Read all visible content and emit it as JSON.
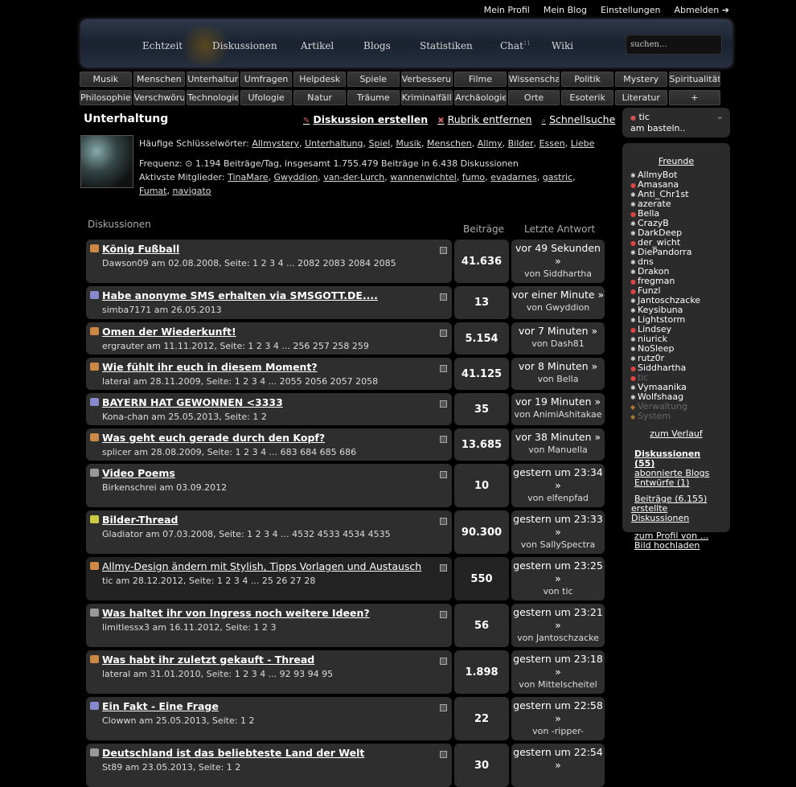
{
  "topnav": [
    "Mein Profil",
    "Mein Blog",
    "Einstellungen",
    "Abmelden ➔"
  ],
  "mainnav": {
    "items": [
      "Echtzeit",
      "Diskussionen",
      "Artikel",
      "Blogs",
      "Statistiken",
      "Chat",
      "Wiki"
    ],
    "chat_badge": "11"
  },
  "search": {
    "placeholder": "suchen..."
  },
  "categories_row1": [
    "Musik",
    "Menschen",
    "Unterhaltung",
    "Umfragen",
    "Helpdesk",
    "Spiele",
    "Verbesserungen",
    "Filme",
    "Wissenschaft",
    "Politik",
    "Mystery",
    "Spiritualität"
  ],
  "categories_row2": [
    "Philosophie",
    "Verschwörungen",
    "Technologie",
    "Ufologie",
    "Natur",
    "Träume",
    "Kriminalfälle",
    "Archäologie",
    "Orte",
    "Esoterik",
    "Literatur",
    "+"
  ],
  "page": {
    "title": "Unterhaltung",
    "create": "Diskussion erstellen",
    "remove": "Rubrik entfernen",
    "quick": "Schnellsuche"
  },
  "info": {
    "keywords_label": "Häufige Schlüsselwörter:",
    "keywords": [
      "Allmystery",
      "Unterhaltung",
      "Spiel",
      "Musik",
      "Menschen",
      "Allmy",
      "Bilder",
      "Essen",
      "Liebe"
    ],
    "freq": "Frequenz: ⊙ 1.194 Beiträge/Tag, insgesamt 1.755.479 Beiträge in 6.438 Diskussionen",
    "active_label": "Aktivste Mitglieder:",
    "active": [
      "TinaMare",
      "Gwyddion",
      "van-der-Lurch",
      "wannenwichtel",
      "fumo",
      "evadarnes",
      "gastric",
      "Fumat",
      "navigato"
    ]
  },
  "table": {
    "heading": "Diskussionen",
    "col_posts": "Beiträge",
    "col_last": "Letzte Antwort"
  },
  "threads": [
    {
      "title": "König Fußball",
      "meta": "Dawson09 am 02.08.2008, Seite: 1 2 3 4 ... 2082 2083 2084 2085",
      "posts": "41.636",
      "last": "vor 49 Sekunden »",
      "by": "von Siddhartha",
      "icon": "#c84",
      "bold": true
    },
    {
      "title": "Habe anonyme SMS erhalten via SMSGOTT.DE....",
      "meta": "simba7171 am 26.05.2013",
      "posts": "13",
      "last": "vor einer Minute »",
      "by": "von Gwyddion",
      "icon": "#88c",
      "bold": true
    },
    {
      "title": "Omen der Wiederkunft!",
      "meta": "ergrauter am 11.11.2012, Seite: 1 2 3 4 ... 256 257 258 259",
      "posts": "5.154",
      "last": "vor 7 Minuten »",
      "by": "von Dash81",
      "icon": "#c84",
      "bold": true
    },
    {
      "title": "Wie fühlt ihr euch in diesem Moment?",
      "meta": "lateral am 28.11.2009, Seite: 1 2 3 4 ... 2055 2056 2057 2058",
      "posts": "41.125",
      "last": "vor 8 Minuten »",
      "by": "von Bella",
      "icon": "#c84",
      "bold": true
    },
    {
      "title": "BAYERN HAT GEWONNEN <3333",
      "meta": "Kona-chan am 25.05.2013, Seite: 1 2",
      "posts": "35",
      "last": "vor 19 Minuten »",
      "by": "von AnimiAshitakae",
      "icon": "#88c",
      "bold": true
    },
    {
      "title": "Was geht euch gerade durch den Kopf?",
      "meta": "splicer am 28.08.2009, Seite: 1 2 3 4 ... 683 684 685 686",
      "posts": "13.685",
      "last": "vor 38 Minuten »",
      "by": "von Manuella",
      "icon": "#c84",
      "bold": true
    },
    {
      "title": "Video Poems",
      "meta": "Birkenschrei am 03.09.2012",
      "posts": "10",
      "last": "gestern um 23:34 »",
      "by": "von elfenpfad",
      "icon": "#999",
      "bold": true
    },
    {
      "title": "Bilder-Thread",
      "meta": "Gladiator am 07.03.2008, Seite: 1 2 3 4 ... 4532 4533 4534 4535",
      "posts": "90.300",
      "last": "gestern um 23:33 »",
      "by": "von SallySpectra",
      "icon": "#cc4",
      "bold": true
    },
    {
      "title": "Allmy-Design ändern mit Stylish, Tipps Vorlagen und Austausch",
      "meta": "tic am 28.12.2012, Seite: 1 2 3 4 ... 25 26 27 28",
      "posts": "550",
      "last": "gestern um 23:25 »",
      "by": "von tic",
      "icon": "#c84",
      "bold": false
    },
    {
      "title": "Was haltet ihr von Ingress noch weitere Ideen?",
      "meta": "limitlessx3 am 16.11.2012, Seite: 1 2 3",
      "posts": "56",
      "last": "gestern um 23:21 »",
      "by": "von Jantoschzacke",
      "icon": "#999",
      "bold": true
    },
    {
      "title": "Was habt ihr zuletzt gekauft - Thread",
      "meta": "lateral am 31.01.2010, Seite: 1 2 3 4 ... 92 93 94 95",
      "posts": "1.898",
      "last": "gestern um 23:18 »",
      "by": "von Mittelscheitel",
      "icon": "#c84",
      "bold": true
    },
    {
      "title": "Ein Fakt - Eine Frage",
      "meta": "Clowwn am 25.05.2013, Seite: 1 2",
      "posts": "22",
      "last": "gestern um 22:58 »",
      "by": "von -ripper-",
      "icon": "#88c",
      "bold": true
    },
    {
      "title": "Deutschland ist das beliebteste Land der Welt",
      "meta": "St89 am 23.05.2013, Seite: 1 2",
      "posts": "30",
      "last": "gestern um 22:54 »",
      "by": "",
      "icon": "#999",
      "bold": true
    }
  ],
  "status": {
    "user": "tic",
    "text": "am basteln.."
  },
  "sidebar": {
    "friends_heading": "Freunde",
    "friends": [
      "AllmyBot",
      "Amasana",
      "Anti_Chr1st",
      "azerate",
      "Bella",
      "CrazyB",
      "DarkDeep",
      "der_wicht",
      "DiePandorra",
      "dns",
      "Drakon",
      "fregman",
      "Funzl",
      "Jantoschzacke",
      "Keysibuna",
      "Lightstorm",
      "Lindsey",
      "niurick",
      "NoSleep",
      "rutz0r",
      "Siddhartha",
      "tic",
      "Vymaanika",
      "Wolfshaag",
      "Verwaltung",
      "System"
    ],
    "history": "zum Verlauf",
    "disc": "Diskussionen (55)",
    "blogs": "abonnierte Blogs",
    "drafts": "Entwürfe (1)",
    "posts": "Beiträge (6.155)",
    "created": "erstellte Diskussionen",
    "profile": "zum Profil von ...",
    "upload": "Bild hochladen"
  }
}
